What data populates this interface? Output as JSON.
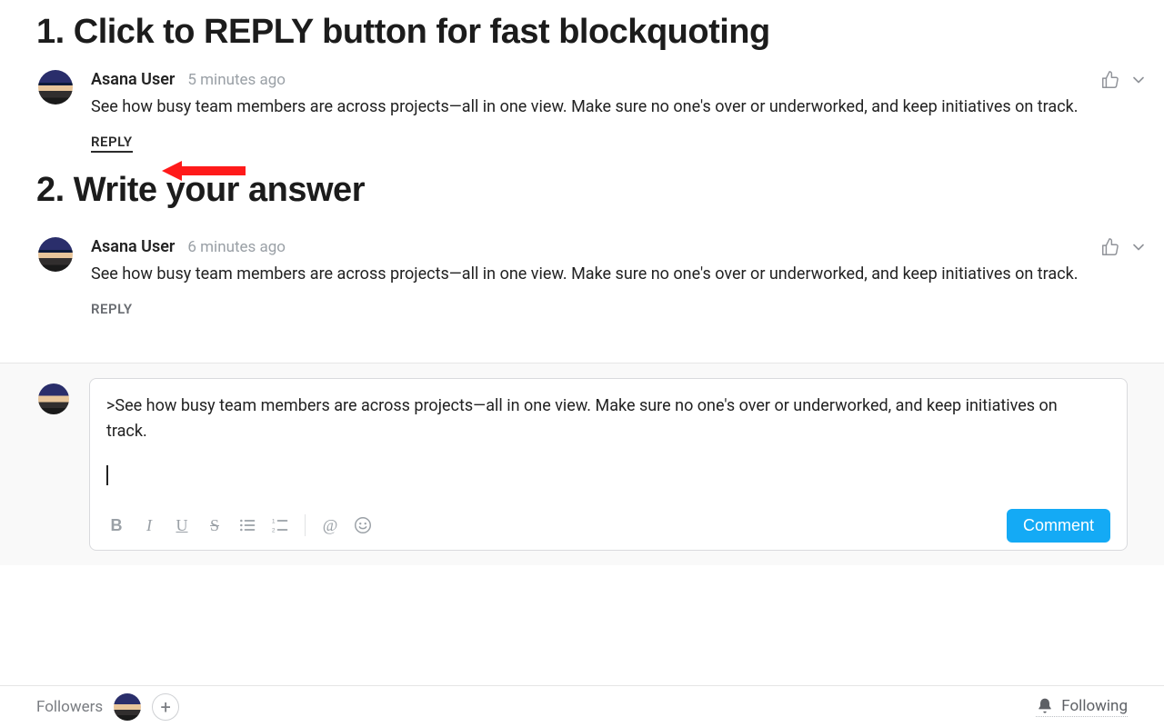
{
  "steps": {
    "one": "1. Click to REPLY button for fast blockquoting",
    "two": "2. Write your answer"
  },
  "comments": [
    {
      "author": "Asana User",
      "time": "5 minutes ago",
      "body": "See how busy team members are across projects—all in one view. Make sure no one's over or underworked, and keep initiatives on track.",
      "reply_label": "REPLY",
      "emphasized_reply": true
    },
    {
      "author": "Asana User",
      "time": "6 minutes ago",
      "body": "See how busy team members are across projects—all in one view. Make sure no one's over or underworked, and keep initiatives on track.",
      "reply_label": "REPLY",
      "emphasized_reply": false
    }
  ],
  "composer": {
    "quoted_text": ">See how busy team members are across projects—all in one view. Make sure no one's over or underworked, and keep initiatives on track.",
    "submit_label": "Comment",
    "toolbar_labels": {
      "bold": "B",
      "italic": "I",
      "underline": "U",
      "strike": "S",
      "mention": "@"
    }
  },
  "footer": {
    "followers_label": "Followers",
    "following_label": "Following"
  }
}
